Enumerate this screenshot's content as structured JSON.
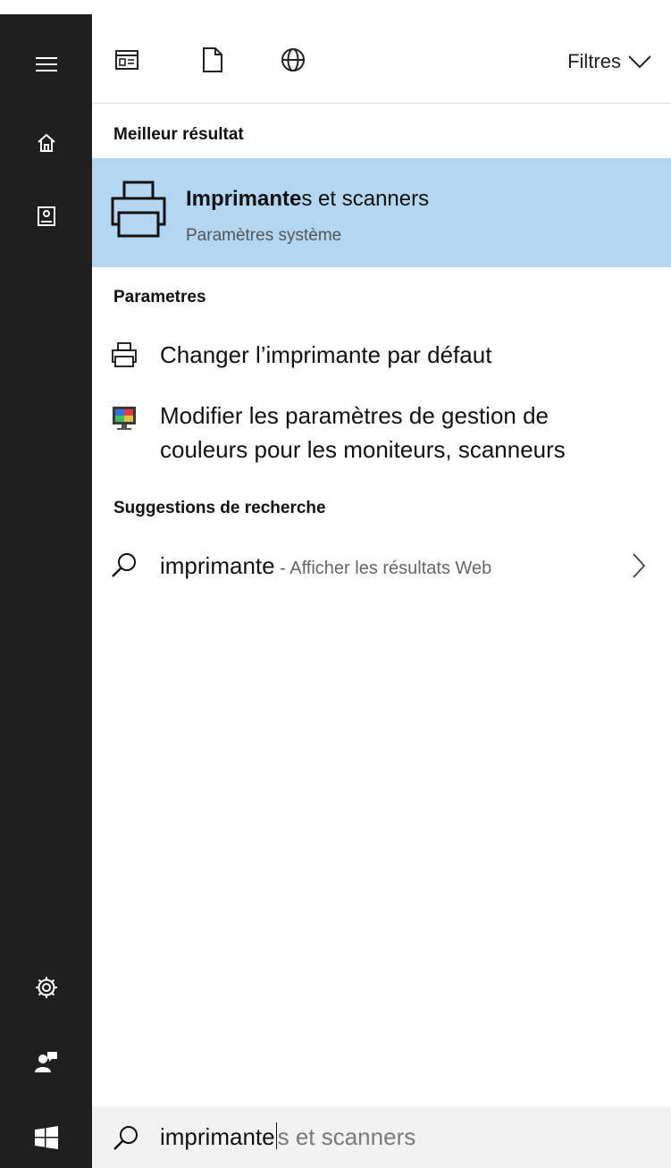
{
  "toolbar": {
    "filters_label": "Filtres",
    "icons": [
      "apps-icon",
      "document-icon",
      "globe-icon",
      "chevron-down-icon"
    ]
  },
  "best_match": {
    "heading": "Meilleur résultat",
    "title_bold": "Imprimante",
    "title_rest": "s et scanners",
    "subtitle": "Paramètres système",
    "icon": "printer-icon"
  },
  "settings": {
    "heading": "Parametres",
    "items": [
      {
        "label": "Changer l’imprimante par défaut",
        "icon": "printer-small-icon"
      },
      {
        "label_line1": "Modifier les paramètres de gestion de",
        "label_line2": "couleurs pour les moniteurs, scanneurs",
        "icon": "monitor-color-icon"
      }
    ]
  },
  "suggestions": {
    "heading": "Suggestions de recherche",
    "items": [
      {
        "query": "imprimante",
        "hint": " - Afficher les résultats Web",
        "icon": "search-icon"
      }
    ]
  },
  "search_box": {
    "typed": "imprimante",
    "autocomplete": "s et scanners"
  },
  "rail": {
    "icons": [
      "hamburger-menu-icon",
      "home-icon",
      "notebook-icon",
      "settings-gear-icon",
      "feedback-icon",
      "windows-start-icon"
    ]
  },
  "colors": {
    "rail_bg": "#1f1f1f",
    "highlight": "#b3d7f3",
    "searchbox_bg": "#f2f2f2"
  }
}
